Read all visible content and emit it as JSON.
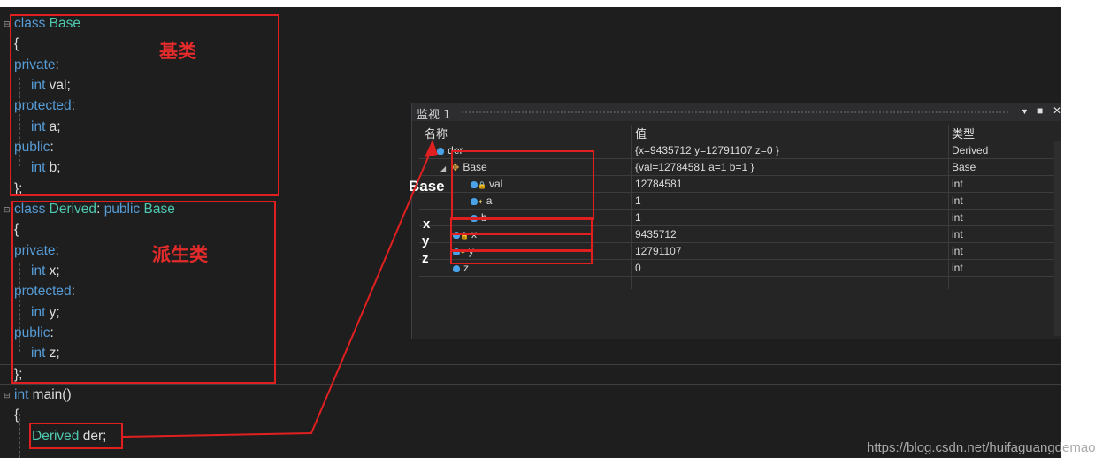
{
  "code": {
    "lines": [
      {
        "kw1": "class",
        "ty": "Base"
      },
      {
        "txt": "{"
      },
      {
        "kw": "private",
        "punc": ":"
      },
      {
        "kw": "int",
        "rest": " val;"
      },
      {
        "kw": "protected",
        "punc": ":"
      },
      {
        "kw": "int",
        "rest": " a;"
      },
      {
        "kw": "public",
        "punc": ":"
      },
      {
        "kw": "int",
        "rest": " b;"
      },
      {
        "txt": "};"
      },
      {
        "kw1": "class",
        "ty": "Derived",
        "mid": ":",
        "kw2": "public",
        "ty2": "Base"
      },
      {
        "txt": "{"
      },
      {
        "kw": "private",
        "punc": ":"
      },
      {
        "kw": "int",
        "rest": " x;"
      },
      {
        "kw": "protected",
        "punc": ":"
      },
      {
        "kw": "int",
        "rest": " y;"
      },
      {
        "kw": "public",
        "punc": ":"
      },
      {
        "kw": "int",
        "rest": " z;"
      },
      {
        "txt": "};"
      },
      {
        "kw": "int",
        "rest": " main()"
      },
      {
        "txt": "{"
      },
      {
        "ty": "Derived",
        "rest": " der;"
      }
    ]
  },
  "annotations": {
    "base_class_label": "基类",
    "derived_class_label": "派生类",
    "base_label": "Base",
    "x_label": "x",
    "y_label": "y",
    "z_label": "z"
  },
  "watch": {
    "title": "监视 1",
    "columns": {
      "name": "名称",
      "value": "值",
      "type": "类型"
    },
    "rows": [
      {
        "name": "der",
        "value": "{x=9435712 y=12791107 z=0 }",
        "type": "Derived"
      },
      {
        "name": "Base",
        "value": "{val=12784581 a=1 b=1 }",
        "type": "Base"
      },
      {
        "name": "val",
        "value": "12784581",
        "type": "int"
      },
      {
        "name": "a",
        "value": "1",
        "type": "int"
      },
      {
        "name": "b",
        "value": "1",
        "type": "int"
      },
      {
        "name": "x",
        "value": "9435712",
        "type": "int"
      },
      {
        "name": "y",
        "value": "12791107",
        "type": "int"
      },
      {
        "name": "z",
        "value": "0",
        "type": "int"
      }
    ]
  },
  "watermark": "https://blog.csdn.net/huifaguangdemao",
  "colors": {
    "keyword": "#569cd6",
    "type": "#4ec9b0",
    "annotation_red": "#e02020"
  }
}
